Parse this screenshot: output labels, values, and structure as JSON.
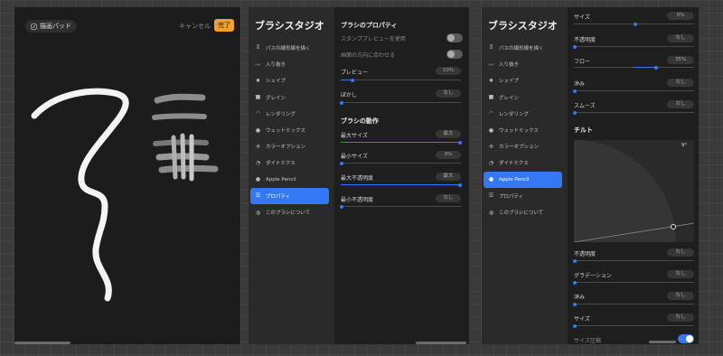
{
  "pad": {
    "title": "描画パッド",
    "cancel_label": "キャンセル",
    "done_label": "完了"
  },
  "brush_studio": {
    "title": "ブラシスタジオ",
    "items": [
      {
        "label": "パスの線形線を描く",
        "icon": "stroke-path-icon"
      },
      {
        "label": "入り抜き",
        "icon": "taper-icon"
      },
      {
        "label": "シェイプ",
        "icon": "shape-icon"
      },
      {
        "label": "グレイン",
        "icon": "grain-icon"
      },
      {
        "label": "レンダリング",
        "icon": "rendering-icon"
      },
      {
        "label": "ウェットミックス",
        "icon": "wet-mix-icon"
      },
      {
        "label": "カラーオプション",
        "icon": "color-options-icon"
      },
      {
        "label": "ダイナミクス",
        "icon": "dynamics-icon"
      },
      {
        "label": "Apple Pencil",
        "icon": "apple-pencil-icon"
      },
      {
        "label": "プロパティ",
        "icon": "properties-icon"
      },
      {
        "label": "このブラシについて",
        "icon": "about-brush-icon"
      }
    ]
  },
  "properties": {
    "section_title": "ブラシのプロパティ",
    "stamp_preview_label": "スタンププレビューを使用",
    "orient_screen_label": "画面の方向に合わせる",
    "preview_label": "プレビュー",
    "preview_value": "10%",
    "preview_fraction": 0.1,
    "blur_label": "ぼかし",
    "blur_value": "なし",
    "behavior_title": "ブラシの動作",
    "max_size_label": "最大サイズ",
    "max_size_value": "最大",
    "min_size_label": "最小サイズ",
    "min_size_value": "0%",
    "max_opacity_label": "最大不透明度",
    "max_opacity_value": "最大",
    "min_opacity_label": "最小不透明度",
    "min_opacity_value": "なし"
  },
  "pencil": {
    "size_label": "サイズ",
    "size_value": "0%",
    "opacity_label": "不透明度",
    "opacity_value": "なし",
    "flow_label": "フロー",
    "flow_value": "35%",
    "bleed_label": "滲み",
    "bleed_value": "なし",
    "smooth_label": "スムーズ",
    "smooth_value": "なし",
    "tilt_title": "チルト",
    "tilt_angle": "9°",
    "tilt_opacity_label": "不透明度",
    "tilt_opacity_value": "なし",
    "gradation_label": "グラデーション",
    "gradation_value": "なし",
    "tilt_bleed_label": "滲み",
    "tilt_bleed_value": "なし",
    "tilt_size_label": "サイズ",
    "tilt_size_value": "なし",
    "size_pressure_label": "サイズ圧縮"
  },
  "colors": {
    "accent": "#3478f6",
    "done_button": "#f0a030"
  }
}
